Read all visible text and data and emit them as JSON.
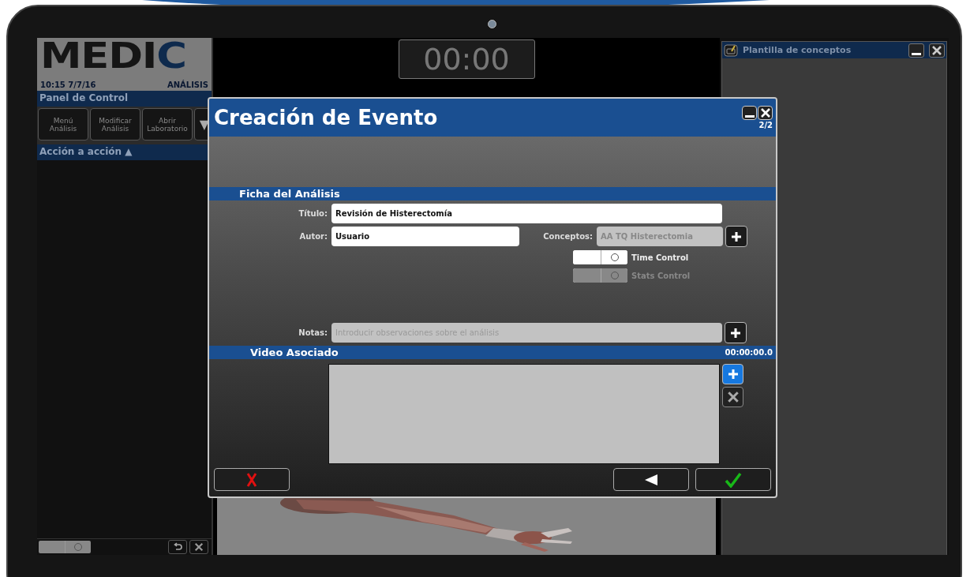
{
  "left_panel": {
    "logo": "MEDIC",
    "time": "10:15 7/7/16",
    "mode": "ANÁLISIS",
    "panel_title": "Panel de Control",
    "buttons": [
      "Menú Análisis",
      "Modificar Análisis",
      "Abrir Laboratorio"
    ],
    "more_button": "▼",
    "section": "Acción a acción ▲",
    "toggle": {
      "on": false
    }
  },
  "timer": "00:00",
  "side_window": {
    "title": "Plantilla de conceptos"
  },
  "dialog": {
    "title": "Creación de Evento",
    "page": "2/2",
    "section": "Ficha del Análisis",
    "titulo": {
      "label": "Título:",
      "value": "Revisión de Histerectomía"
    },
    "autor": {
      "label": "Autor:",
      "value": "Usuario"
    },
    "conceptos": {
      "label": "Conceptos:",
      "value": "AA TQ Histerectomia",
      "disabled": true
    },
    "toggles": [
      {
        "label": "Time Control",
        "disabled": false
      },
      {
        "label": "Stats Control",
        "disabled": true
      }
    ],
    "notas": {
      "label": "Notas:",
      "placeholder": "Introducir observaciones sobre el análisis"
    },
    "video": {
      "title": "Video Asociado",
      "time": "00:00:00.0"
    }
  }
}
